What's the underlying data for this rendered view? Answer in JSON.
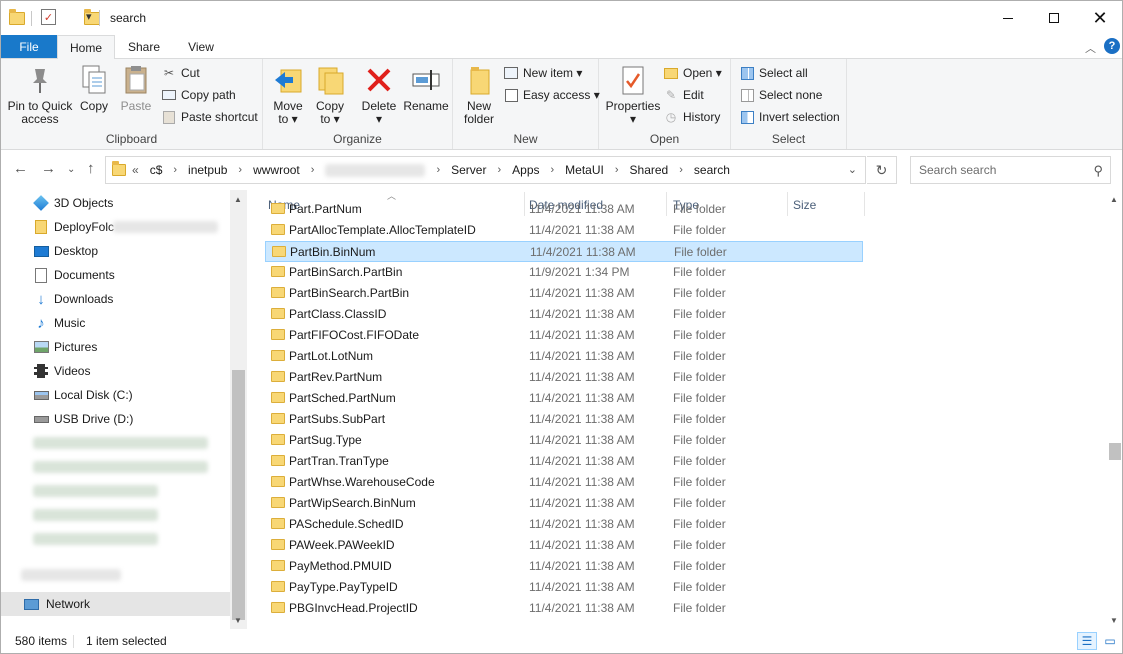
{
  "window": {
    "title": "search"
  },
  "ribbon_tabs": {
    "file": "File",
    "home": "Home",
    "share": "Share",
    "view": "View"
  },
  "clipboard": {
    "label": "Clipboard",
    "pin_line1": "Pin to Quick",
    "pin_line2": "access",
    "copy": "Copy",
    "paste": "Paste",
    "cut": "Cut",
    "copy_path": "Copy path",
    "paste_shortcut": "Paste shortcut"
  },
  "organize": {
    "label": "Organize",
    "move_line1": "Move",
    "move_line2": "to ▾",
    "copy_line1": "Copy",
    "copy_line2": "to ▾",
    "delete_line1": "Delete",
    "delete_line2": "▾",
    "rename": "Rename"
  },
  "new_group": {
    "label": "New",
    "new_folder_line1": "New",
    "new_folder_line2": "folder",
    "new_item": "New item ▾",
    "easy_access": "Easy access ▾"
  },
  "open_group": {
    "label": "Open",
    "properties_line1": "Properties",
    "properties_line2": "▾",
    "open": "Open ▾",
    "edit": "Edit",
    "history": "History"
  },
  "select_group": {
    "label": "Select",
    "select_all": "Select all",
    "select_none": "Select none",
    "invert": "Invert selection"
  },
  "address": {
    "overflow": "«",
    "crumbs": [
      "c$",
      "inetpub",
      "wwwroot",
      "",
      "Server",
      "Apps",
      "MetaUI",
      "Shared",
      "search"
    ]
  },
  "search": {
    "placeholder": "Search search"
  },
  "nav_pane": {
    "items": [
      {
        "label": "3D Objects",
        "icon": "3d-objects-icon"
      },
      {
        "label": "DeployFolc",
        "icon": "folder-icon"
      },
      {
        "label": "Desktop",
        "icon": "desktop-icon"
      },
      {
        "label": "Documents",
        "icon": "documents-icon"
      },
      {
        "label": "Downloads",
        "icon": "downloads-icon"
      },
      {
        "label": "Music",
        "icon": "music-icon"
      },
      {
        "label": "Pictures",
        "icon": "pictures-icon"
      },
      {
        "label": "Videos",
        "icon": "videos-icon"
      },
      {
        "label": "Local Disk (C:)",
        "icon": "drive-icon"
      },
      {
        "label": "USB Drive (D:)",
        "icon": "usb-drive-icon"
      }
    ],
    "network": "Network"
  },
  "columns": {
    "name": "Name",
    "date": "Date modified",
    "type": "Type",
    "size": "Size"
  },
  "files": [
    {
      "name": "Part.PartNum",
      "date": "11/4/2021 11:38 AM",
      "type": "File folder"
    },
    {
      "name": "PartAllocTemplate.AllocTemplateID",
      "date": "11/4/2021 11:38 AM",
      "type": "File folder"
    },
    {
      "name": "PartBin.BinNum",
      "date": "11/4/2021 11:38 AM",
      "type": "File folder"
    },
    {
      "name": "PartBinSarch.PartBin",
      "date": "11/9/2021 1:34 PM",
      "type": "File folder"
    },
    {
      "name": "PartBinSearch.PartBin",
      "date": "11/4/2021 11:38 AM",
      "type": "File folder"
    },
    {
      "name": "PartClass.ClassID",
      "date": "11/4/2021 11:38 AM",
      "type": "File folder"
    },
    {
      "name": "PartFIFOCost.FIFODate",
      "date": "11/4/2021 11:38 AM",
      "type": "File folder"
    },
    {
      "name": "PartLot.LotNum",
      "date": "11/4/2021 11:38 AM",
      "type": "File folder"
    },
    {
      "name": "PartRev.PartNum",
      "date": "11/4/2021 11:38 AM",
      "type": "File folder"
    },
    {
      "name": "PartSched.PartNum",
      "date": "11/4/2021 11:38 AM",
      "type": "File folder"
    },
    {
      "name": "PartSubs.SubPart",
      "date": "11/4/2021 11:38 AM",
      "type": "File folder"
    },
    {
      "name": "PartSug.Type",
      "date": "11/4/2021 11:38 AM",
      "type": "File folder"
    },
    {
      "name": "PartTran.TranType",
      "date": "11/4/2021 11:38 AM",
      "type": "File folder"
    },
    {
      "name": "PartWhse.WarehouseCode",
      "date": "11/4/2021 11:38 AM",
      "type": "File folder"
    },
    {
      "name": "PartWipSearch.BinNum",
      "date": "11/4/2021 11:38 AM",
      "type": "File folder"
    },
    {
      "name": "PASchedule.SchedID",
      "date": "11/4/2021 11:38 AM",
      "type": "File folder"
    },
    {
      "name": "PAWeek.PAWeekID",
      "date": "11/4/2021 11:38 AM",
      "type": "File folder"
    },
    {
      "name": "PayMethod.PMUID",
      "date": "11/4/2021 11:38 AM",
      "type": "File folder"
    },
    {
      "name": "PayType.PayTypeID",
      "date": "11/4/2021 11:38 AM",
      "type": "File folder"
    },
    {
      "name": "PBGInvcHead.ProjectID",
      "date": "11/4/2021 11:38 AM",
      "type": "File folder"
    }
  ],
  "selected_index": 2,
  "status": {
    "count": "580 items",
    "selected": "1 item selected"
  },
  "colors": {
    "accent": "#1979ca",
    "selection": "#cce8ff",
    "folder": "#f8d775"
  }
}
